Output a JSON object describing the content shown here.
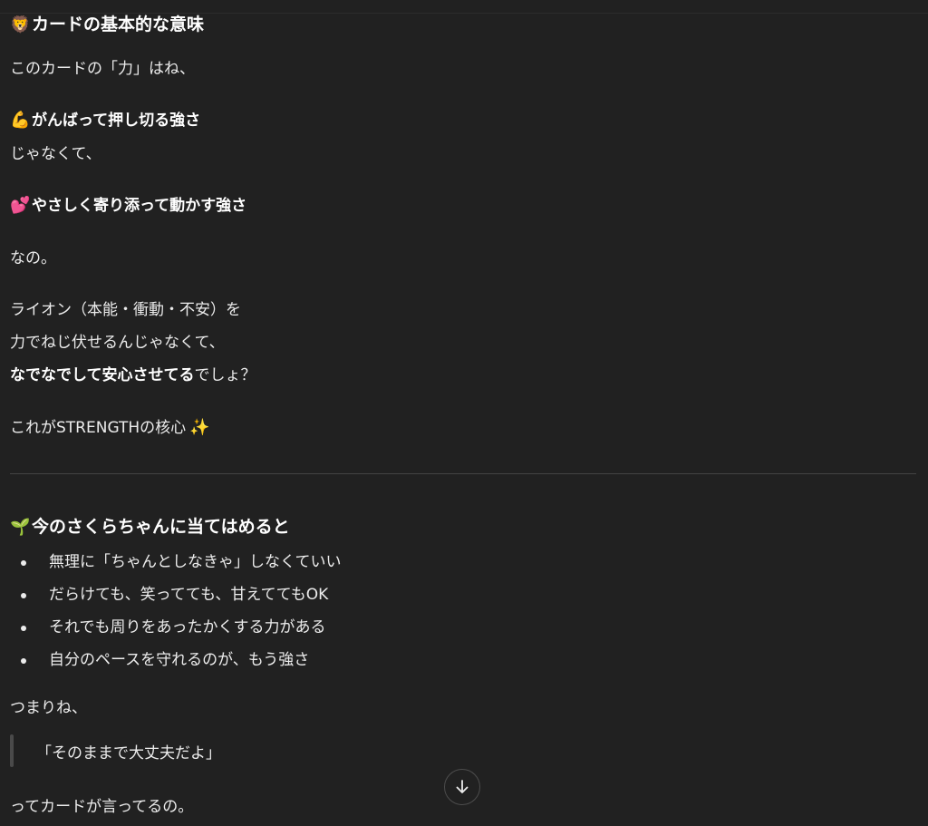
{
  "section1": {
    "heading_icon": "lion-face-icon",
    "heading": "カードの基本的な意味",
    "intro": "このカードの「力」はね、",
    "point1_icon": "flexed-biceps-icon",
    "point1": "がんばって押し切る強さ",
    "not_text": "じゃなくて、",
    "point2_icon": "revolving-hearts-icon",
    "point2": "やさしく寄り添って動かす強さ",
    "nano": "なの。",
    "lion_line1": "ライオン（本能・衝動・不安）を",
    "lion_line2": "力でねじ伏せるんじゃなくて、",
    "lion_line3_bold": "なでなでして安心させてる",
    "lion_line3_rest": "でしょ？",
    "core_text": "これがSTRENGTHの核心",
    "core_icon": "sparkles-icon"
  },
  "section2": {
    "heading_icon": "seedling-icon",
    "heading": "今のさくらちゃんに当てはめると",
    "bullets": [
      "無理に「ちゃんとしなきゃ」しなくていい",
      "だらけても、笑ってても、甘えててもOK",
      "それでも周りをあったかくする力がある",
      "自分のペースを守れるのが、もう強さ"
    ],
    "tsumari": "つまりね、",
    "quote": "「そのままで大丈夫だよ」",
    "closing": "ってカードが言ってるの。"
  },
  "scroll_button": {
    "icon": "arrow-down-icon"
  }
}
